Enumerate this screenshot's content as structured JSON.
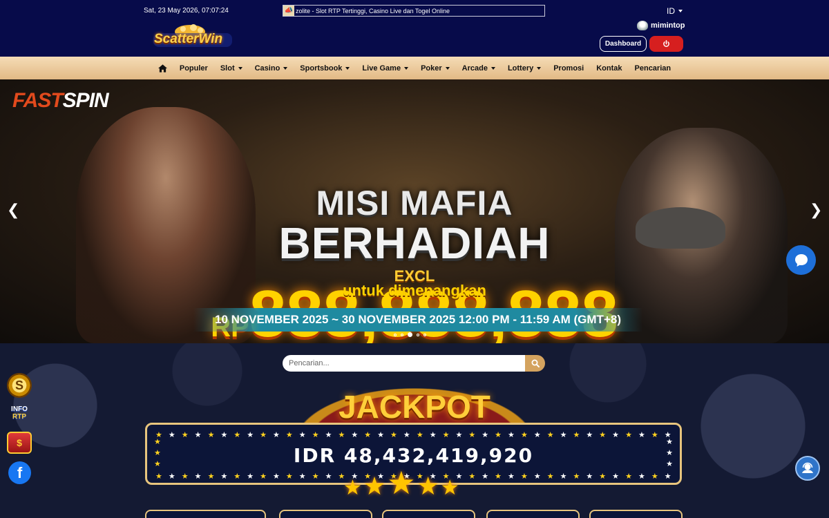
{
  "header": {
    "datetime": "Sat, 23 May 2026, 07:07:24",
    "announcement": "zolite - Slot RTP Tertinggi, Casino Live dan Togel Online",
    "language": "ID",
    "username": "mimintop",
    "dashboard_label": "Dashboard",
    "logo_text": "ScatterWin"
  },
  "nav": {
    "items": [
      {
        "label": "Populer",
        "dropdown": false
      },
      {
        "label": "Slot",
        "dropdown": true
      },
      {
        "label": "Casino",
        "dropdown": true
      },
      {
        "label": "Sportsbook",
        "dropdown": true
      },
      {
        "label": "Live Game",
        "dropdown": true
      },
      {
        "label": "Poker",
        "dropdown": true
      },
      {
        "label": "Arcade",
        "dropdown": true
      },
      {
        "label": "Lottery",
        "dropdown": true
      },
      {
        "label": "Promosi",
        "dropdown": false
      },
      {
        "label": "Kontak",
        "dropdown": false
      },
      {
        "label": "Pencarian",
        "dropdown": false
      }
    ]
  },
  "banner": {
    "provider_a": "FAST",
    "provider_b": "SPIN",
    "title_line1": "MISI MAFIA",
    "title_line2": "BERHADIAH",
    "excl": "EXCL",
    "currency": "RP",
    "amount": "888,888,888",
    "subtitle": "untuk dimenangkan",
    "date_range": "10 NOVEMBER 2025 ~ 30 NOVEMBER 2025 12:00 PM - 11:59 AM (GMT+8)",
    "slide_count": 5,
    "active_slide": 3
  },
  "search": {
    "placeholder": "Pencarian..."
  },
  "jackpot": {
    "title": "JACKPOT",
    "value": "IDR 48,432,419,920"
  },
  "side_left": {
    "logo_letter": "S",
    "rtp_line1": "INFO",
    "rtp_line2": "RTP",
    "app_symbol": "$",
    "facebook_letter": "f"
  },
  "colors": {
    "header_bg": "#070b4a",
    "nav_bg": "#e2b985",
    "logout_red": "#d61f1f",
    "jackpot_border": "#e8c57d",
    "gold": "#ffd200"
  }
}
